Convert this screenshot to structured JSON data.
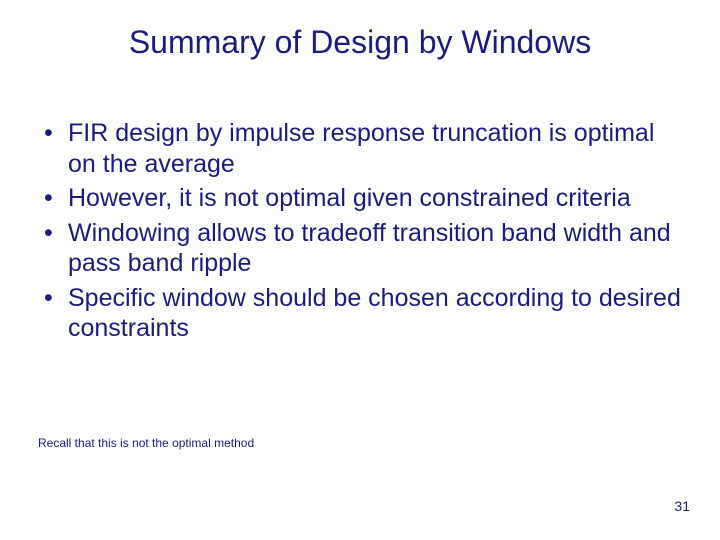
{
  "title": "Summary of Design by Windows",
  "bullets": [
    "FIR design by impulse response truncation is optimal on the average",
    "However, it is not optimal given constrained criteria",
    "Windowing allows to tradeoff transition band width and pass band ripple",
    "Specific window should be chosen according to desired constraints"
  ],
  "footnote": "Recall that this is not the optimal method",
  "page_number": "31"
}
